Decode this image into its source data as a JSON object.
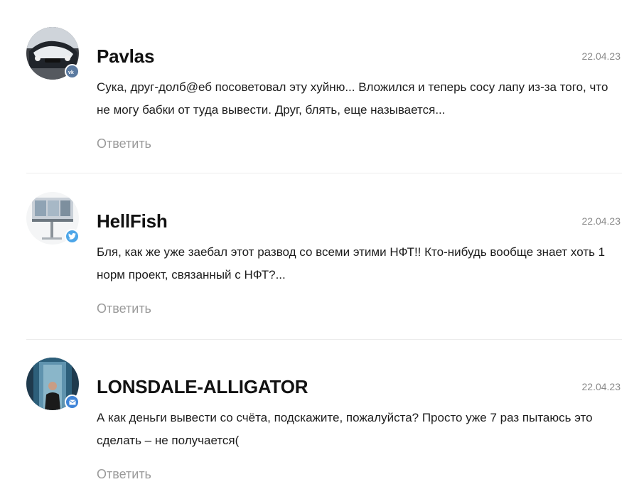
{
  "comments": [
    {
      "author": "Pavlas",
      "date": "22.04.23",
      "text": "Сука, друг-долб@еб посоветовал эту хуйню... Вложился и теперь сосу лапу из-за того, что не могу бабки от туда вывести. Друг, блять, еще называется...",
      "reply_label": "Ответить",
      "badge": {
        "icon": "vk-icon",
        "color": "#5b7aa0"
      }
    },
    {
      "author": "HellFish",
      "date": "22.04.23",
      "text": "Бля, как же уже заебал этот развод со всеми этими НФТ!! Кто-нибудь вообще знает хоть 1 норм проект, связанный с НФТ?...",
      "reply_label": "Ответить",
      "badge": {
        "icon": "twitter-icon",
        "color": "#4da6e8"
      }
    },
    {
      "author": "LONSDALE-ALLIGATOR",
      "date": "22.04.23",
      "text": "А как деньги вывести со счёта, подскажите, пожалуйста? Просто уже 7 раз пытаюсь это сделать – не получается(",
      "reply_label": "Ответить",
      "badge": {
        "icon": "mail-icon",
        "color": "#3f84d8"
      }
    }
  ]
}
